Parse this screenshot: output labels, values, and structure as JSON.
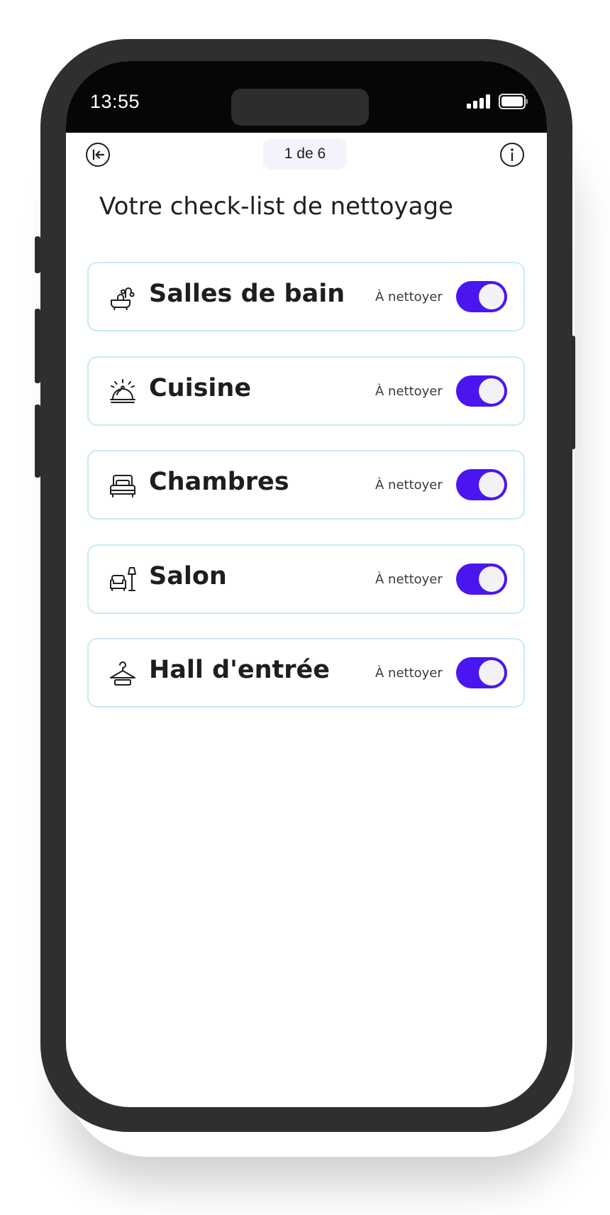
{
  "status_bar": {
    "time": "13:55",
    "signal_icon": "cellular-signal-icon",
    "battery_icon": "battery-icon"
  },
  "header": {
    "back_icon": "exit-back-icon",
    "pager": "1 de 6",
    "info_icon": "info-icon"
  },
  "title": "Votre check-list de nettoyage",
  "rooms": [
    {
      "label": "Salles de bain",
      "status": "À nettoyer",
      "icon": "bathtub-icon",
      "enabled": true
    },
    {
      "label": "Cuisine",
      "status": "À nettoyer",
      "icon": "cloche-icon",
      "enabled": true
    },
    {
      "label": "Chambres",
      "status": "À nettoyer",
      "icon": "bed-icon",
      "enabled": true
    },
    {
      "label": "Salon",
      "status": "À nettoyer",
      "icon": "armchair-lamp-icon",
      "enabled": true
    },
    {
      "label": "Hall d'entrée",
      "status": "À nettoyer",
      "icon": "hanger-icon",
      "enabled": true
    }
  ],
  "colors": {
    "accent": "#4a16f0",
    "card_border": "#c7ebf2",
    "pager_bg": "#f4f2fb"
  }
}
